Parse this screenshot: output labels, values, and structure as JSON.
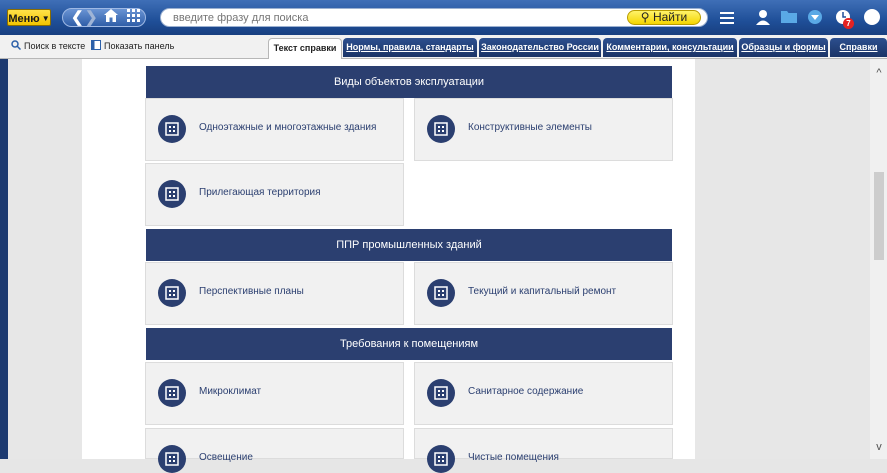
{
  "toolbar": {
    "menu_label": "Меню",
    "search_placeholder": "введите фразу для поиска",
    "find_label": "Найти",
    "notifications_count": "7",
    "help_label": "?"
  },
  "subbar": {
    "search_in_text": "Поиск в тексте",
    "show_panel": "Показать панель"
  },
  "tabs": [
    {
      "label": "Текст справки",
      "active": true
    },
    {
      "label": "Нормы, правила, стандарты",
      "active": false
    },
    {
      "label": "Законодательство России",
      "active": false
    },
    {
      "label": "Комментарии, консультации",
      "active": false
    },
    {
      "label": "Образцы и формы",
      "active": false
    },
    {
      "label": "Справки",
      "active": false
    }
  ],
  "sections": [
    {
      "title": "Виды объектов эксплуатации",
      "cards": [
        "Одноэтажные и многоэтажные здания",
        "Конструктивные элементы",
        "Прилегающая территория"
      ]
    },
    {
      "title": "ППР промышленных зданий",
      "cards": [
        "Перспективные планы",
        "Текущий и капитальный ремонт"
      ]
    },
    {
      "title": "Требования к помещениям",
      "cards": [
        "Микроклимат",
        "Санитарное содержание",
        "Освещение",
        "Чистые помещения"
      ]
    }
  ],
  "colors": {
    "accent_navy": "#2b3f70",
    "toolbar_blue": "#1f4f98",
    "find_yellow": "#f4d500",
    "badge_red": "#e32222"
  }
}
